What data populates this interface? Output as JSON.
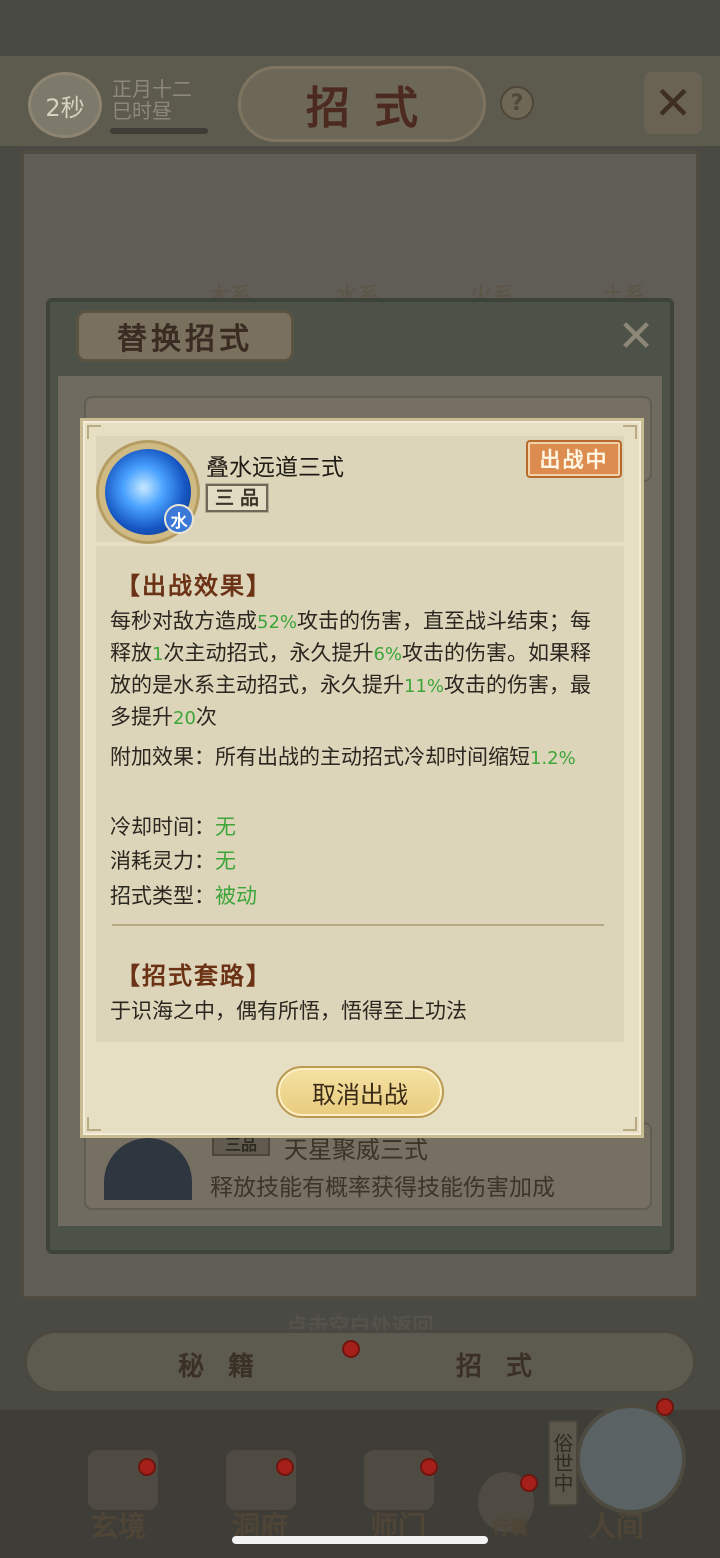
{
  "hud": {
    "timer": "2秒",
    "date_line1": "正月十二",
    "date_line2": "巳时昼",
    "title": "招式",
    "help_icon": "question-icon",
    "close_icon": "close-icon"
  },
  "background": {
    "element_tabs": [
      "木系",
      "水系",
      "火系",
      "土系"
    ],
    "dialog_title": "替换招式",
    "peek_card": {
      "grade": "三品",
      "name": "天星聚威三式",
      "description": "释放技能有概率获得技能伤害加成"
    },
    "hint": "点击空白处返回",
    "bottom_tabs": [
      "秘籍",
      "招式"
    ],
    "nav": [
      "玄境",
      "洞府",
      "师门",
      "行囊",
      "人间"
    ],
    "world_label": "俗世中"
  },
  "modal": {
    "skill_name": "叠水远道三式",
    "grade": "三品",
    "element": "水",
    "status": "出战中",
    "effect_title": "【出战效果】",
    "effect_parts": {
      "p1": "每秒对敌方造成",
      "v1": "52%",
      "p2": "攻击的伤害，直至战斗结束；每释放",
      "v2": "1",
      "p3": "次主动招式，永久提升",
      "v3": "6%",
      "p4": "攻击的伤害。如果释放的是水系主动招式，永久提升",
      "v4": "11%",
      "p5": "攻击的伤害，最多提升",
      "v5": "20",
      "p6": "次"
    },
    "extra_label": "附加效果：所有出战的主动招式冷却时间缩短",
    "extra_value": "1.2%",
    "cooldown_label": "冷却时间：",
    "cooldown_value": "无",
    "cost_label": "消耗灵力：",
    "cost_value": "无",
    "type_label": "招式类型：",
    "type_value": "被动",
    "lore_title": "【招式套路】",
    "lore_text": "于识海之中，偶有所悟，悟得至上功法",
    "cancel_button": "取消出战"
  },
  "colors": {
    "highlight_green": "#3da53a",
    "status_orange": "#dc8c4e",
    "section_brown": "#6c3216"
  }
}
